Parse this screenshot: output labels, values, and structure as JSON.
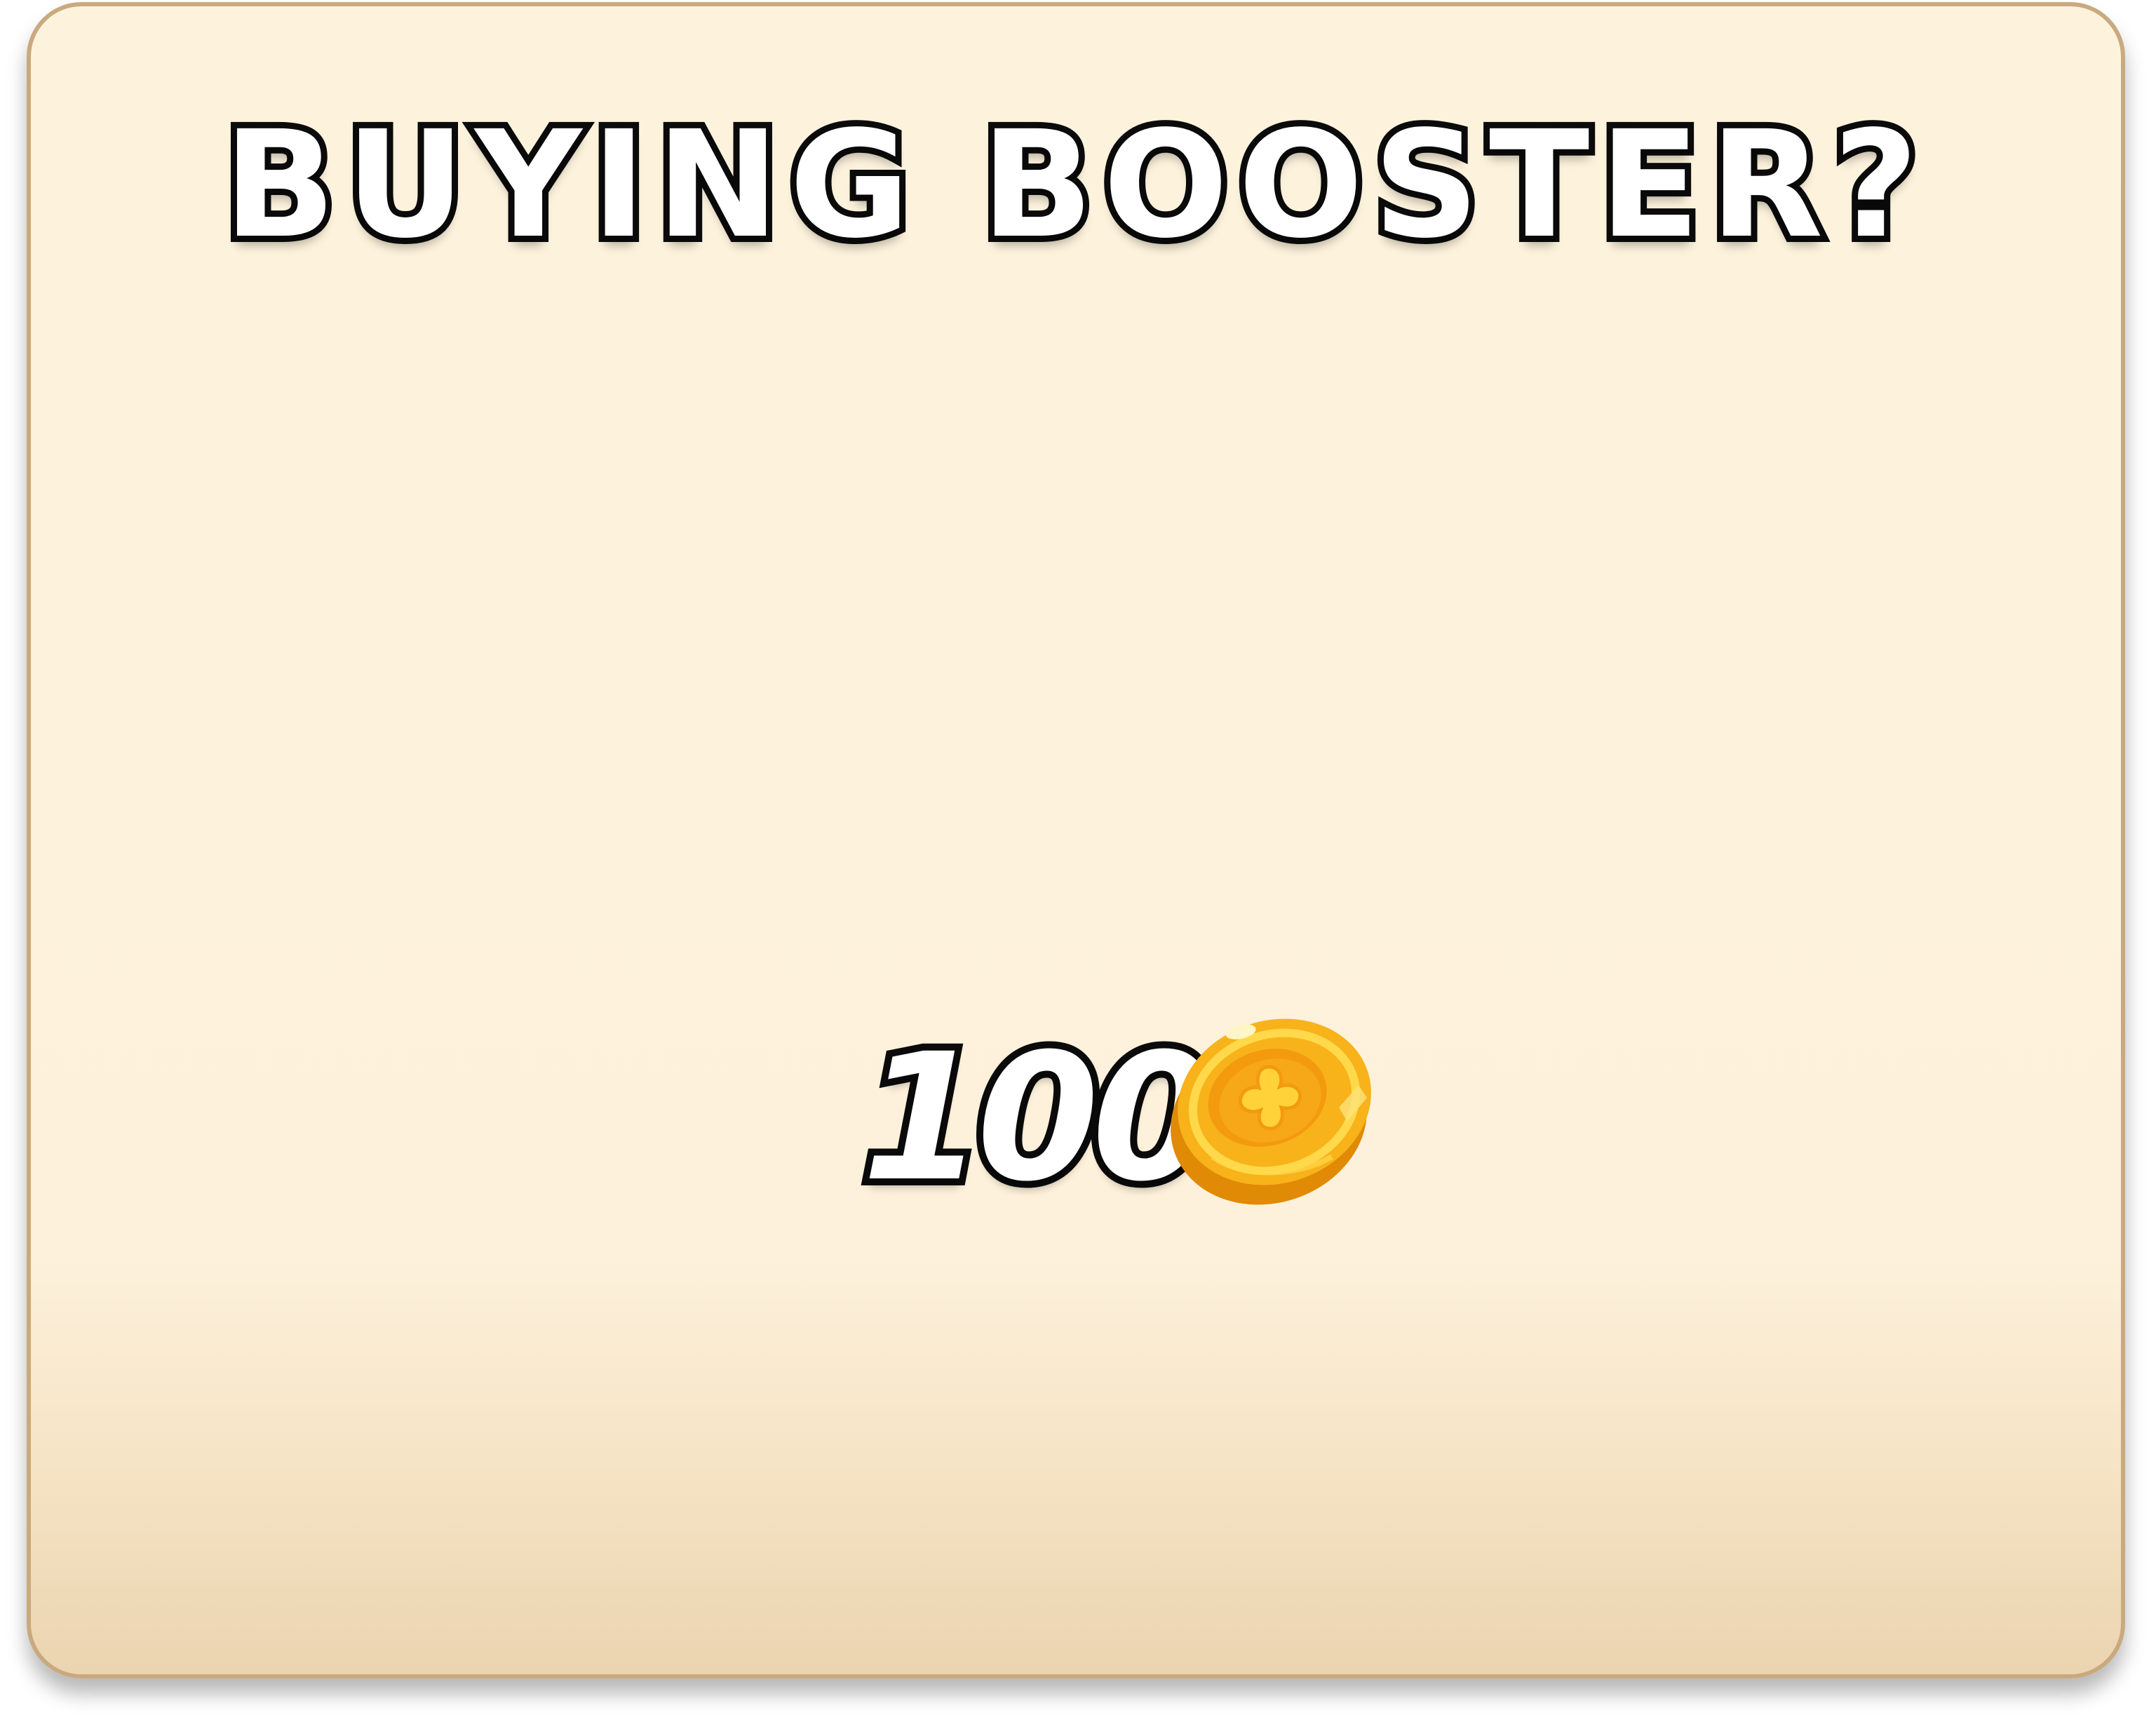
{
  "dialog": {
    "title": "BUYING BOOSTER?",
    "price": {
      "amount": "100",
      "currency_icon": "gold-coin-icon"
    }
  },
  "colors": {
    "panel_background": "#fdf3dd",
    "panel_border": "#c9a97e",
    "text_fill": "#ffffff",
    "text_outline": "#0b0b0b",
    "coin_gold": "#f8b21a",
    "coin_inner": "#f39a0e",
    "coin_highlight": "#ffd94a"
  }
}
